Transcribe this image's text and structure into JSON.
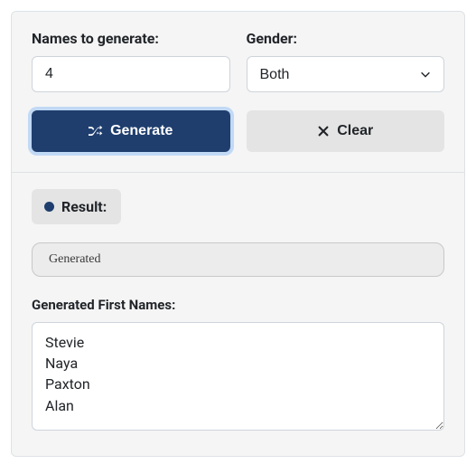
{
  "form": {
    "names_label": "Names to generate:",
    "names_value": "4",
    "gender_label": "Gender:",
    "gender_value": "Both"
  },
  "buttons": {
    "generate_label": "Generate",
    "clear_label": "Clear"
  },
  "result": {
    "chip_label": "Result:",
    "status_text": "Generated",
    "output_label": "Generated First Names:",
    "output_value": "Stevie\nNaya\nPaxton\nAlan"
  }
}
